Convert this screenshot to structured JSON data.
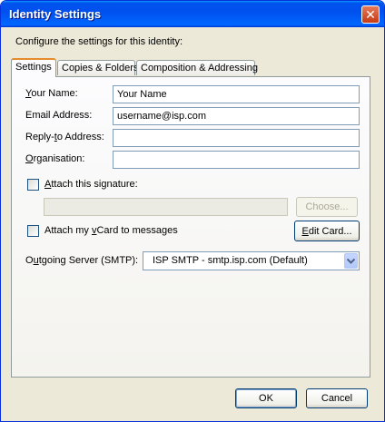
{
  "window": {
    "title": "Identity Settings",
    "close_glyph": "✕"
  },
  "intro": "Configure the settings for this identity:",
  "tabs": [
    {
      "label": "Settings",
      "active": true
    },
    {
      "label": "Copies & Folders",
      "active": false
    },
    {
      "label": "Composition & Addressing",
      "active": false
    }
  ],
  "fields": {
    "your_name": {
      "label_access": "Y",
      "label_rest": "our Name:",
      "value": "Your Name"
    },
    "email": {
      "label": "Email Address:",
      "value": "username@isp.com"
    },
    "reply_to": {
      "label_pre": "Reply-",
      "label_access": "t",
      "label_rest": "o Address:",
      "value": ""
    },
    "organisation": {
      "label_access": "O",
      "label_rest": "rganisation:",
      "value": ""
    }
  },
  "signature": {
    "label_access": "A",
    "label_rest": "ttach this signature:",
    "checked": false,
    "path": "",
    "choose_label": "Choose..."
  },
  "vcard": {
    "label_pre": "Attach my ",
    "label_access": "v",
    "label_rest": "Card to messages",
    "checked": false,
    "edit_label_access": "E",
    "edit_label_pre": "",
    "edit_label_rest": "dit Card..."
  },
  "smtp": {
    "label_pre": "O",
    "label_access": "u",
    "label_rest": "tgoing Server (SMTP):",
    "selected": "ISP SMTP - smtp.isp.com (Default)"
  },
  "footer": {
    "ok_label": "OK",
    "cancel_label": "Cancel"
  },
  "icons": {
    "close": "close-icon",
    "dropdown": "chevron-down-icon"
  }
}
